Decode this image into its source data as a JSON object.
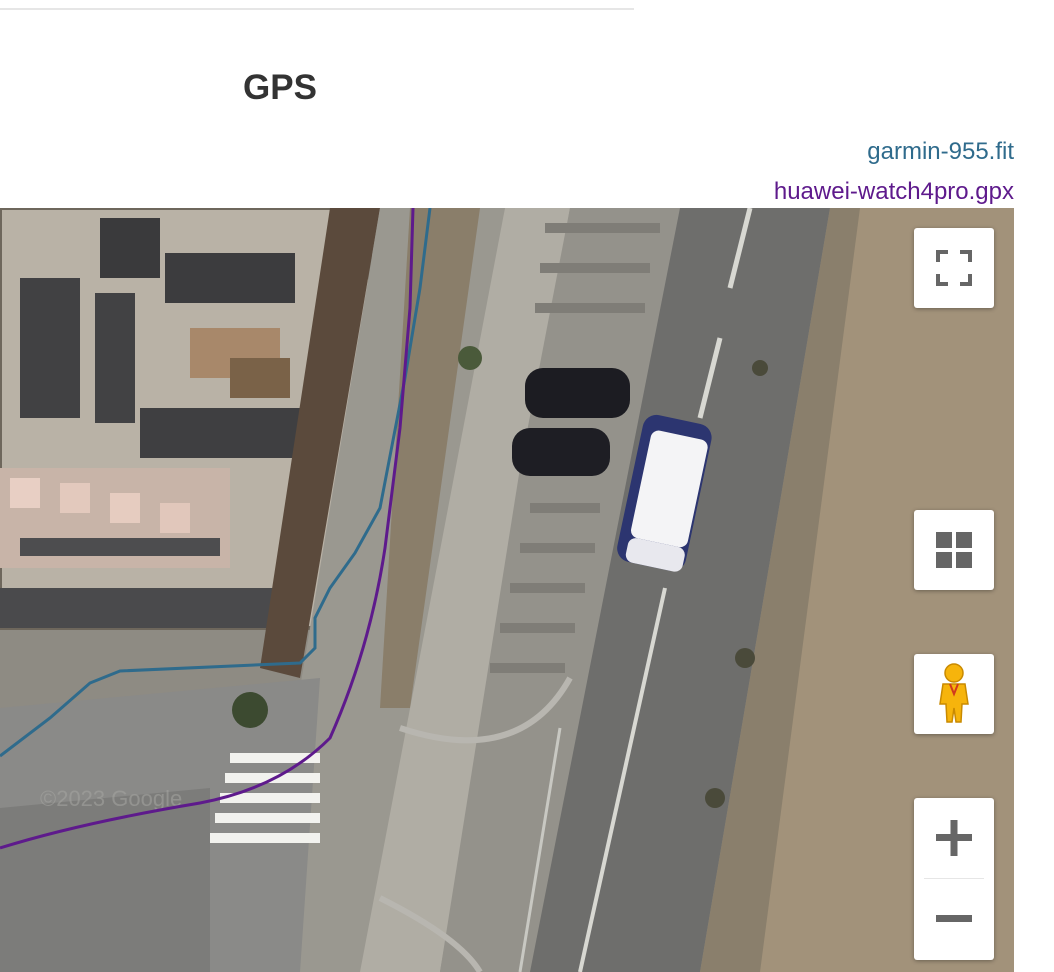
{
  "title": "GPS",
  "tracks": [
    {
      "name": "garmin-955.fit",
      "color": "#2f6b8c"
    },
    {
      "name": "huawei-watch4pro.gpx",
      "color": "#5e1a8c"
    }
  ],
  "map": {
    "type": "satellite",
    "watermark": "©2023 Google"
  },
  "controls": {
    "fullscreen_icon": "fullscreen-icon",
    "map_type_icon": "grid-icon",
    "street_view_icon": "pegman-icon",
    "zoom_in_icon": "plus-icon",
    "zoom_out_icon": "minus-icon"
  }
}
